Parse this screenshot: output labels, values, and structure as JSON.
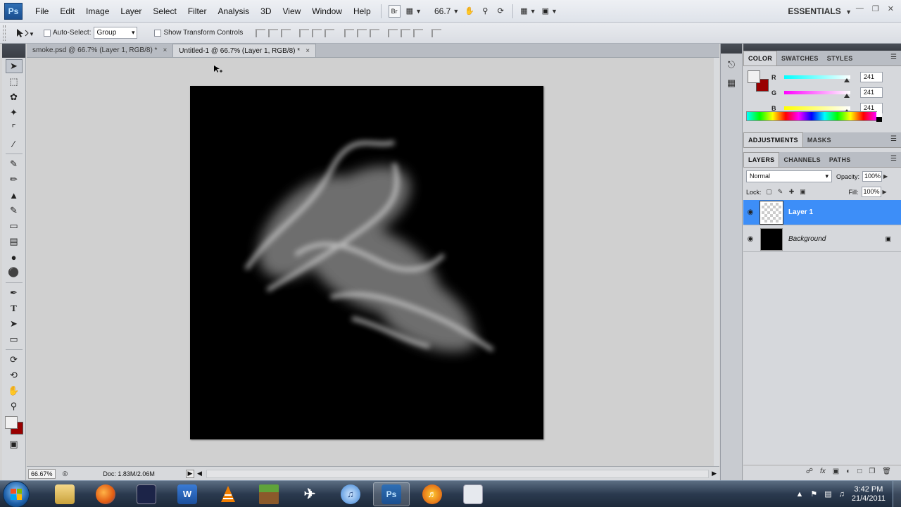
{
  "app": {
    "logo": "Ps",
    "menu": [
      "File",
      "Edit",
      "Image",
      "Layer",
      "Select",
      "Filter",
      "Analysis",
      "3D",
      "View",
      "Window",
      "Help"
    ],
    "bridge_button": "Br",
    "zoom_level": "66.7",
    "workspace": "ESSENTIALS"
  },
  "options_bar": {
    "auto_select_label": "Auto-Select:",
    "auto_select_value": "Group",
    "show_transform_label": "Show Transform Controls"
  },
  "tabs": [
    {
      "label": "smoke.psd @ 66.7% (Layer 1, RGB/8) *",
      "active": false
    },
    {
      "label": "Untitled-1 @ 66.7% (Layer 1, RGB/8) *",
      "active": true
    }
  ],
  "status": {
    "zoom": "66.67%",
    "doc_info": "Doc: 1.83M/2.06M"
  },
  "color_panel": {
    "tabs": [
      "COLOR",
      "SWATCHES",
      "STYLES"
    ],
    "sliders": [
      {
        "label": "R",
        "value": "241",
        "level": 0.945,
        "gradient": "linear-gradient(to right,#00ffff,#ffffff)"
      },
      {
        "label": "G",
        "value": "241",
        "level": 0.945,
        "gradient": "linear-gradient(to right,#ff00ff,#ffffff)"
      },
      {
        "label": "B",
        "value": "241",
        "level": 0.945,
        "gradient": "linear-gradient(to right,#ffff00,#ffffff)"
      }
    ],
    "foreground": "#f1f1f1",
    "background": "#990000"
  },
  "adjustments": {
    "tabs": [
      "ADJUSTMENTS",
      "MASKS"
    ]
  },
  "layers_panel": {
    "tabs": [
      "LAYERS",
      "CHANNELS",
      "PATHS"
    ],
    "blend_mode": "Normal",
    "opacity_label": "Opacity:",
    "opacity": "100%",
    "lock_label": "Lock:",
    "fill_label": "Fill:",
    "fill": "100%",
    "layers": [
      {
        "name": "Layer 1",
        "selected": true
      },
      {
        "name": "Background",
        "selected": false
      }
    ]
  },
  "taskbar": {
    "clock_time": "3:42 PM",
    "clock_date": "21/4/2011"
  },
  "colors": {
    "selection": "#3d8ef8",
    "canvas": "#000000"
  }
}
